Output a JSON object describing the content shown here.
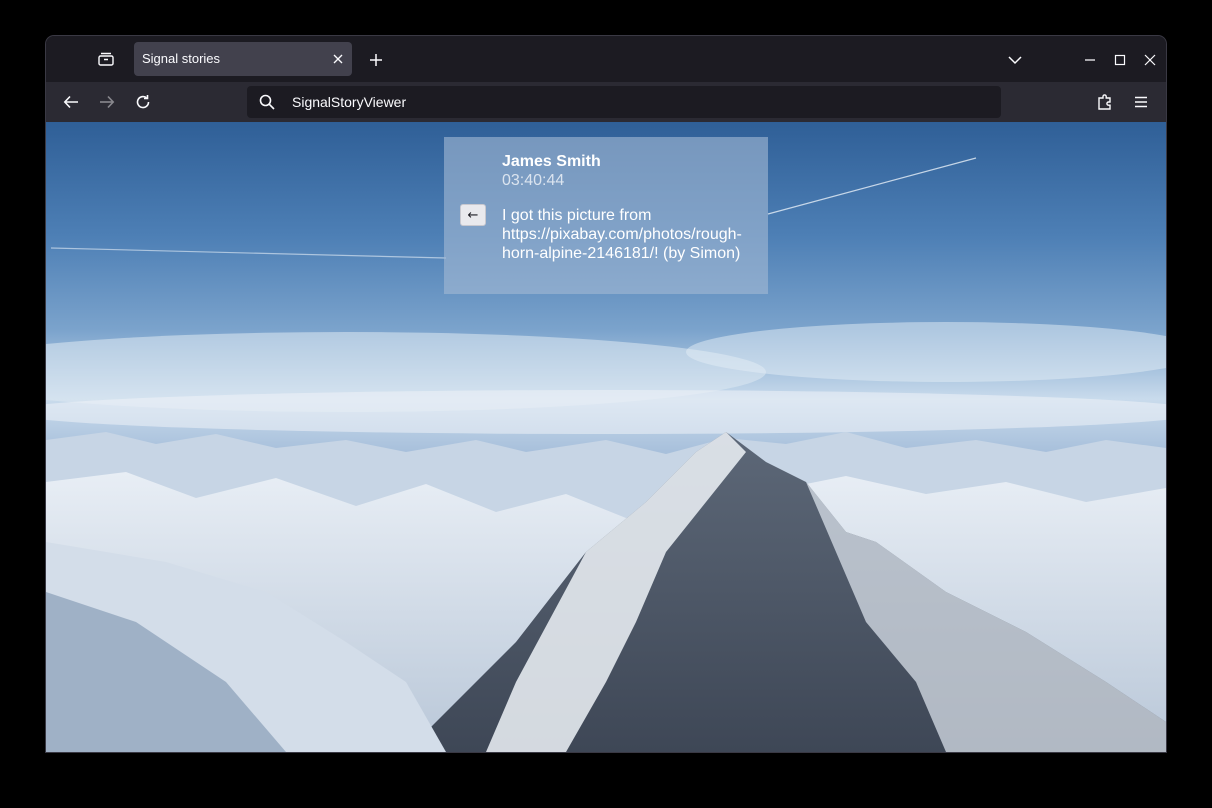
{
  "browser": {
    "tab_title": "Signal stories",
    "url_text": "SignalStoryViewer"
  },
  "icons": {
    "tab_list": "tab-overview-icon",
    "close_tab": "close-icon",
    "new_tab": "plus-icon",
    "list_all_tabs": "chevron-down-icon",
    "minimize": "minimize-icon",
    "maximize": "maximize-icon",
    "close_window": "close-icon",
    "back": "arrow-left-icon",
    "forward": "arrow-right-icon",
    "reload": "reload-icon",
    "search": "search-icon",
    "extensions": "puzzle-icon",
    "menu": "hamburger-menu-icon"
  },
  "story": {
    "author": "James Smith",
    "time": "03:40:44",
    "back_label": "←",
    "message": "I got this picture from https://pixabay.com/photos/rough-horn-alpine-2146181/! (by Simon)"
  },
  "colors": {
    "tabbar_bg": "#1c1b22",
    "navbar_bg": "#2b2a33",
    "active_tab_bg": "#42414d",
    "text": "#fbfbfe"
  }
}
